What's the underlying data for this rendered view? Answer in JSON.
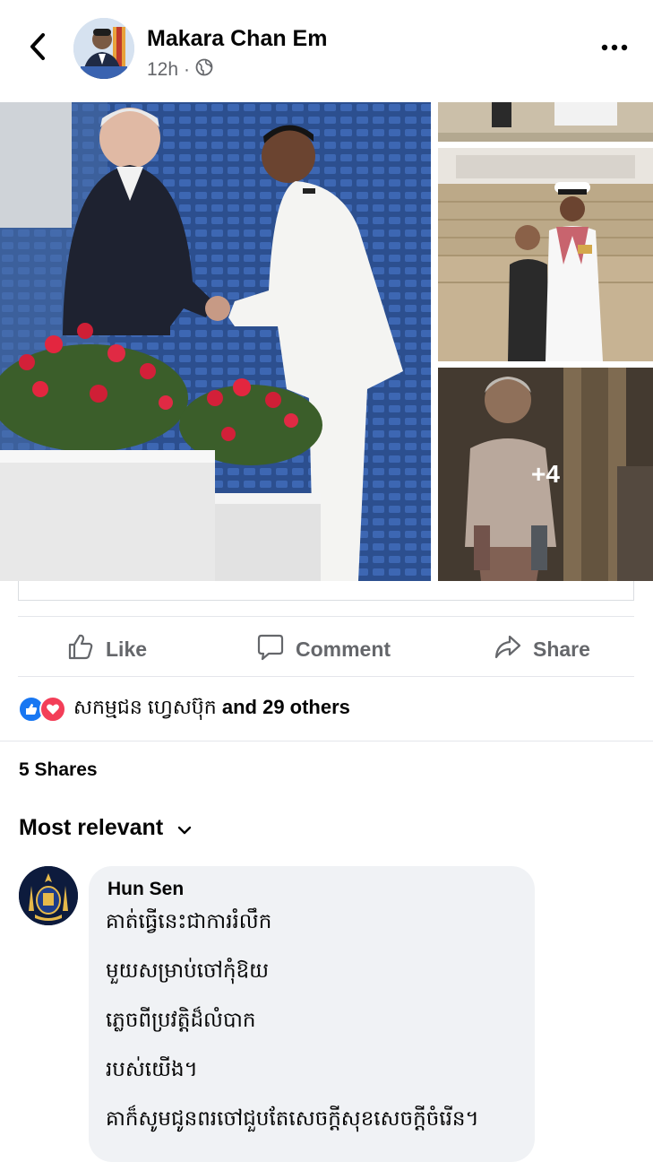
{
  "post": {
    "author": "Makara Chan Em",
    "time": "12h",
    "separator": "·",
    "more_overflow_label": "•••"
  },
  "photos": {
    "more_count": "+4"
  },
  "actions": {
    "like": "Like",
    "comment": "Comment",
    "share": "Share"
  },
  "reactions": {
    "names": "សកម្មជន ហ្វេសប៊ុក",
    "rest": "and 29 others"
  },
  "shares": "5 Shares",
  "sort": {
    "label": "Most relevant"
  },
  "comment": {
    "author": "Hun Sen",
    "lines": [
      "គាត់ធ្វើនេះជាការរំលឹក",
      "មួយសម្រាប់ចៅកុំឱយ",
      "ភ្លេចពីប្រវត្តិដ៏លំបាក",
      "របស់យើង។",
      "គាក៏សូមជូនពរចៅជួបតែសេចក្តីសុខសេចក្តីចំរើន។"
    ]
  },
  "colors": {
    "text_primary": "#050505",
    "text_secondary": "#65676b",
    "like_blue": "#1877f2",
    "love_red": "#f33e58",
    "bubble_bg": "#f0f2f5",
    "divider": "#e4e6eb"
  }
}
